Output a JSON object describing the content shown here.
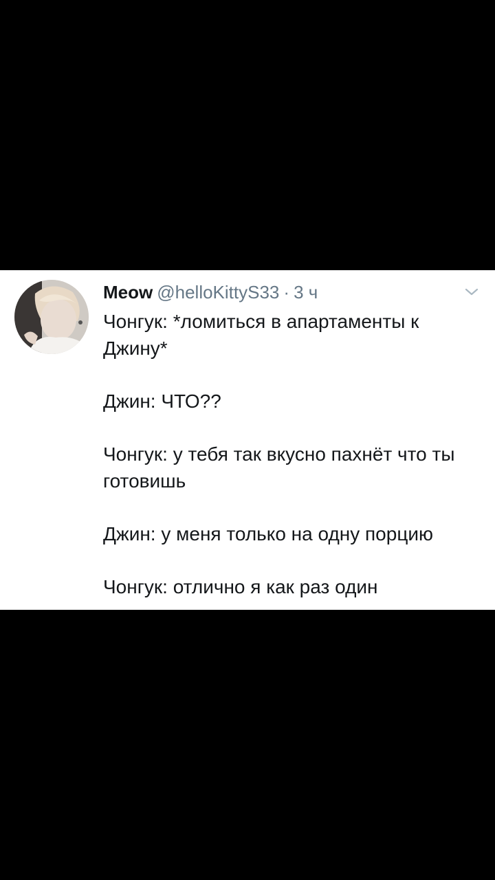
{
  "tweet": {
    "display_name": "Meow",
    "handle": "@helloKittyS33",
    "separator": "·",
    "time": "3 ч",
    "lines": [
      "Чонгук: *ломиться в апартаменты к Джину*",
      "Джин: ЧТО??",
      "Чонгук: у тебя так вкусно пахнёт что ты готовишь",
      "Джин: у меня только на одну порцию",
      "Чонгук: отлично я как раз один"
    ],
    "icons": {
      "avatar": "avatar-photo",
      "caret": "chevron-down-icon"
    }
  },
  "colors": {
    "background": "#000000",
    "card": "#ffffff",
    "text": "#14171a",
    "muted": "#657786"
  }
}
